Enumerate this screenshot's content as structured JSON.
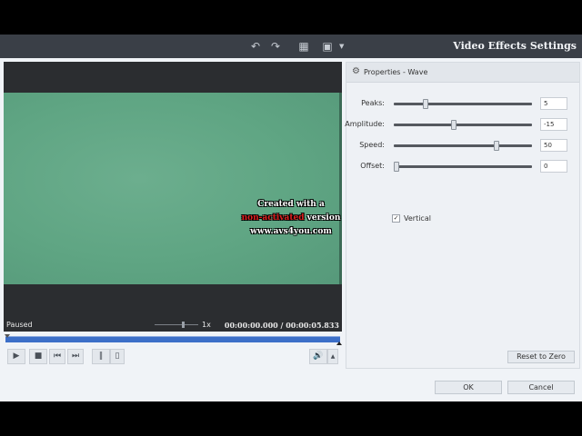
{
  "window": {
    "title": "Video Effects Settings"
  },
  "toolbar": {
    "icons": [
      "undo-icon",
      "redo-icon",
      "grid-icon",
      "monitor-icon",
      "chevron-down-icon"
    ]
  },
  "preview": {
    "watermark": {
      "line1": "Created with a",
      "line2_red": "non-activated",
      "line2_rest": " version",
      "line3": "www.avs4you.com"
    },
    "status": "Paused",
    "speed": "1x",
    "time": "00:00:00.000 / 00:00:05.833"
  },
  "properties": {
    "title": "Properties - Wave",
    "rows": [
      {
        "label": "Peaks:",
        "value": "5",
        "level": 0.22
      },
      {
        "label": "Amplitude:",
        "value": "-15",
        "level": 0.43
      },
      {
        "label": "Speed:",
        "value": "50",
        "level": 0.75
      },
      {
        "label": "Offset:",
        "value": "0",
        "level": 0.0
      }
    ],
    "vertical_label": "Vertical",
    "vertical_checked": true,
    "vertical_mark": "✓",
    "reset_label": "Reset to Zero"
  },
  "footer": {
    "ok_label": "OK",
    "cancel_label": "Cancel"
  }
}
